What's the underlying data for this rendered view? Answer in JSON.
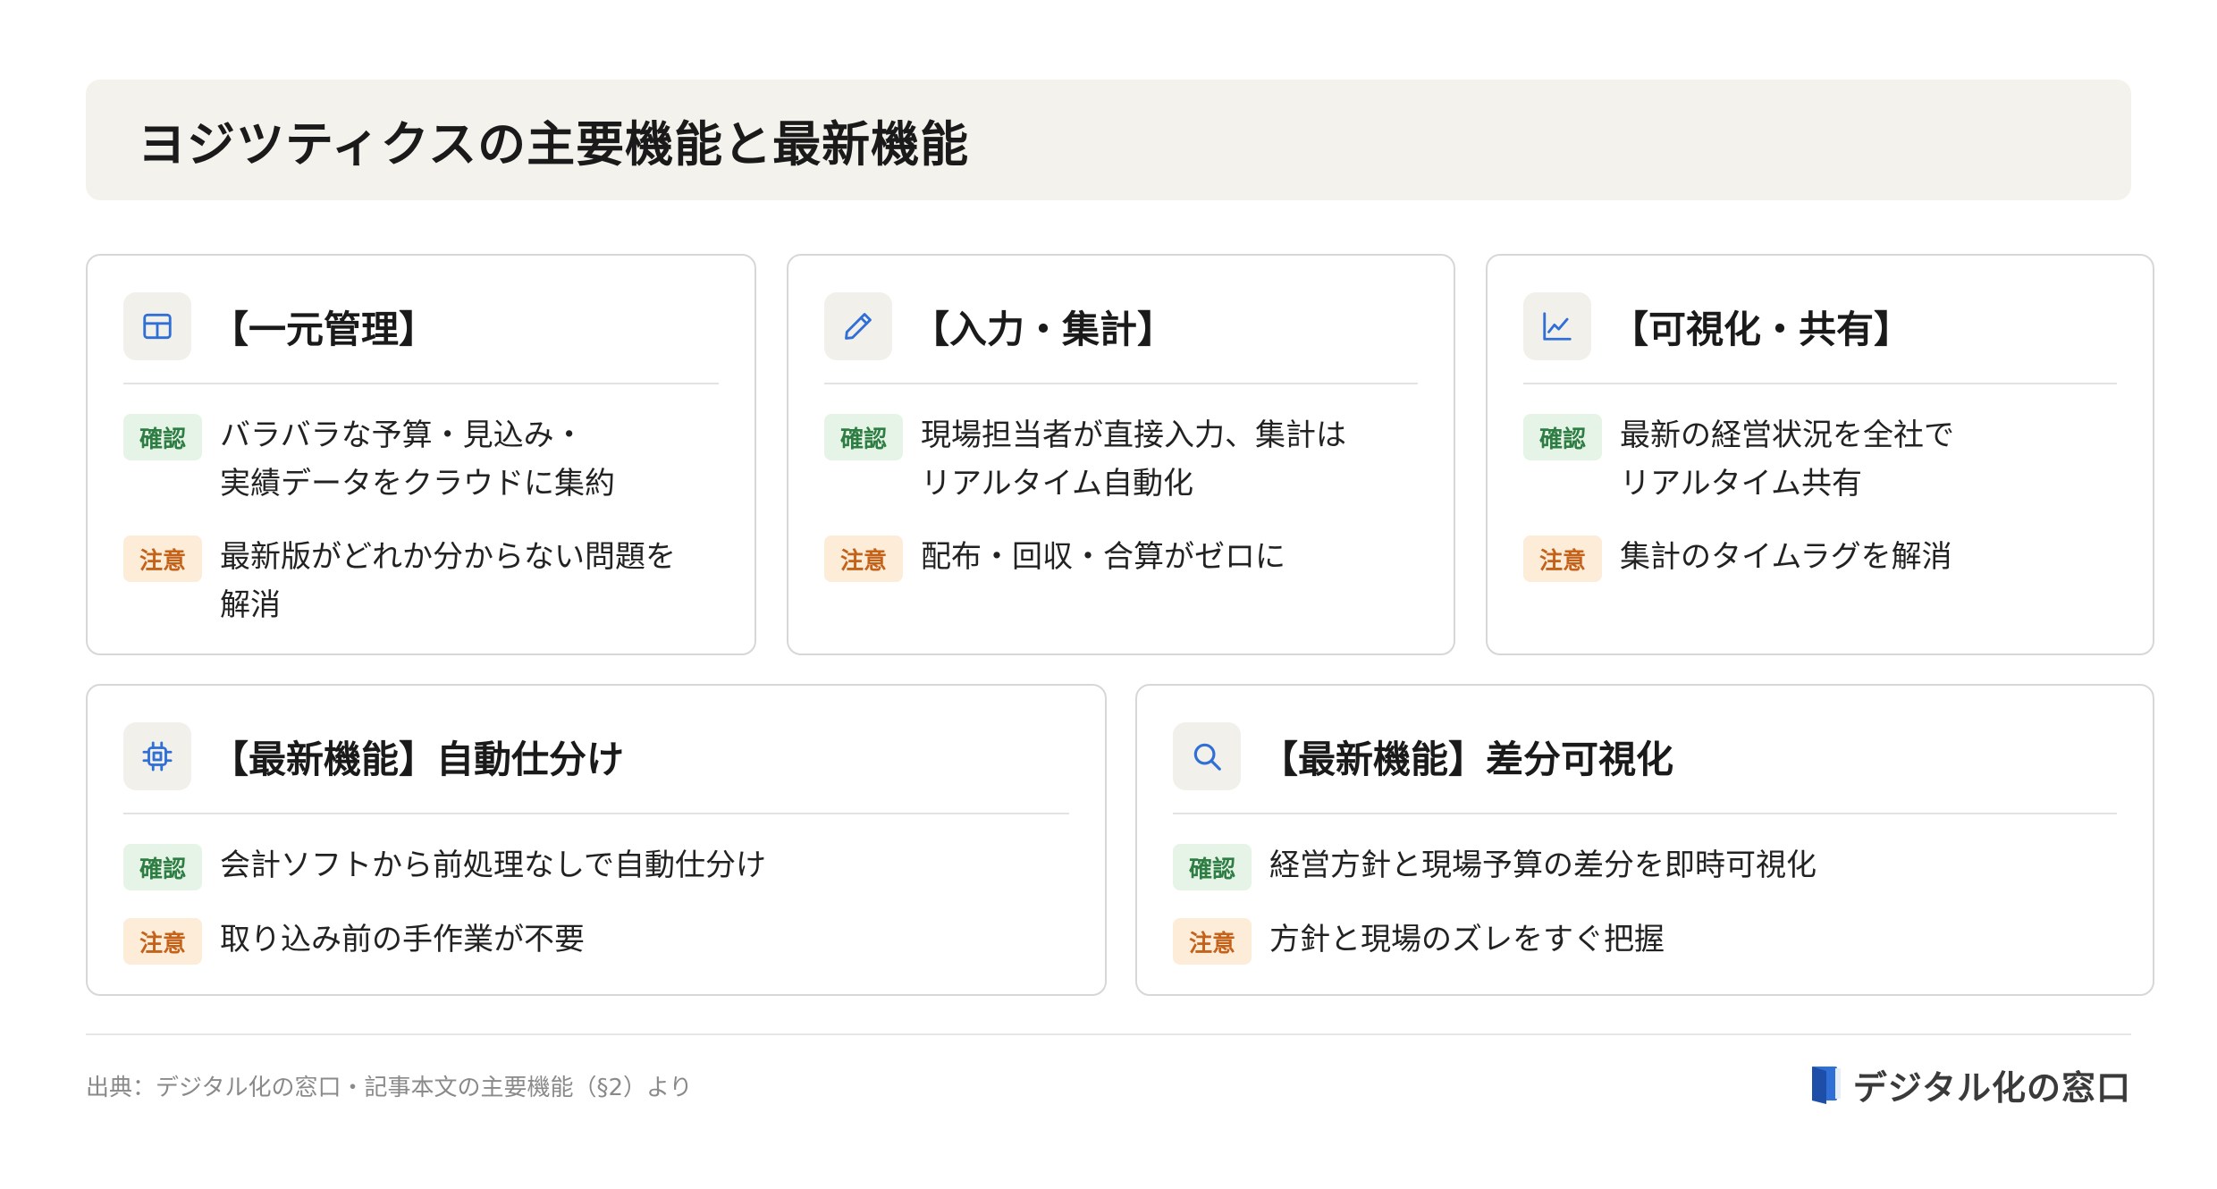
{
  "header": {
    "title": "ヨジツティクスの主要機能と最新機能"
  },
  "badges": {
    "confirm": "確認",
    "caution": "注意"
  },
  "cards": [
    {
      "title": "【一元管理】",
      "icon": "table-icon",
      "confirm": "バラバラな予算・見込み・\n実績データをクラウドに集約",
      "caution": "最新版がどれか分からない問題を\n解消"
    },
    {
      "title": "【入力・集計】",
      "icon": "pencil-icon",
      "confirm": "現場担当者が直接入力、集計は\nリアルタイム自動化",
      "caution": "配布・回収・合算がゼロに"
    },
    {
      "title": "【可視化・共有】",
      "icon": "line-chart-icon",
      "confirm": "最新の経営状況を全社で\nリアルタイム共有",
      "caution": "集計のタイムラグを解消"
    },
    {
      "title": "【最新機能】自動仕分け",
      "icon": "chip-icon",
      "confirm": "会計ソフトから前処理なしで自動仕分け",
      "caution": "取り込み前の手作業が不要"
    },
    {
      "title": "【最新機能】差分可視化",
      "icon": "search-icon",
      "confirm": "経営方針と現場予算の差分を即時可視化",
      "caution": "方針と現場のズレをすぐ把握"
    }
  ],
  "footer": {
    "source": "出典：デジタル化の窓口・記事本文の主要機能（§2）より",
    "brand": "デジタル化の窓口",
    "brand_icon": "door-logo-icon"
  },
  "colors": {
    "icon_blue": "#2f6fd6",
    "confirm_green": "#2e7d43",
    "caution_orange": "#c4621a",
    "header_bg": "#f4f2ed"
  }
}
